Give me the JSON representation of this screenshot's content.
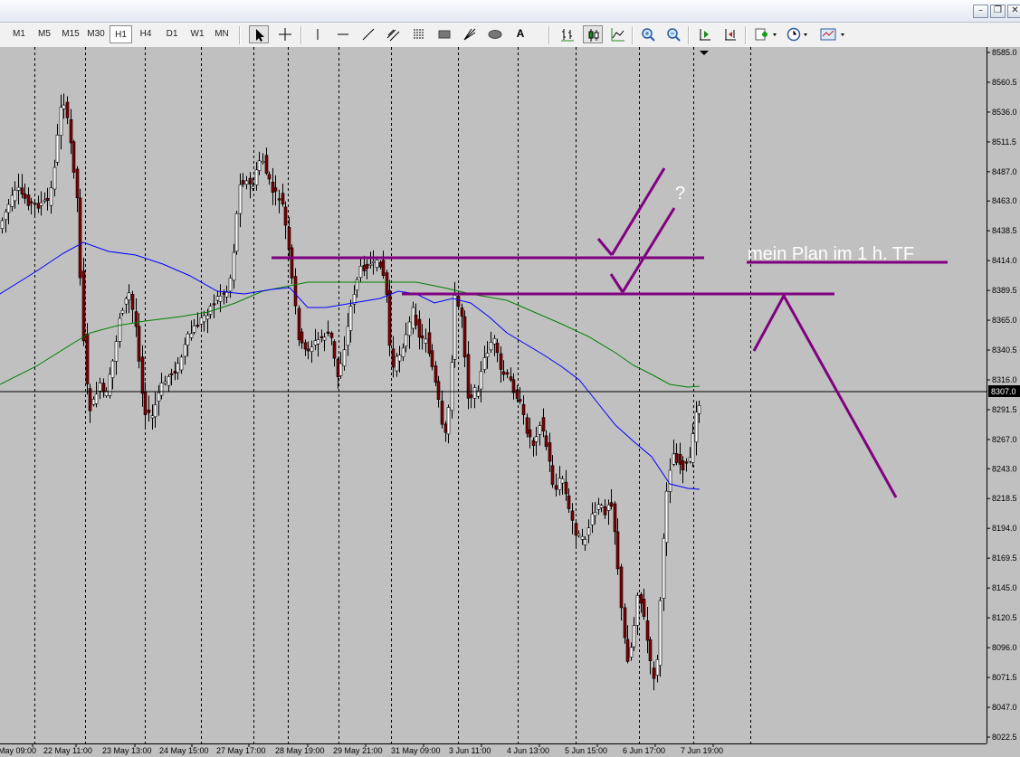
{
  "window": {
    "minimize_icon": "–",
    "restore_icon": "❐",
    "close_icon": "✕"
  },
  "toolbar": {
    "timeframes": [
      "M1",
      "M5",
      "M15",
      "M30",
      "H1",
      "H4",
      "D1",
      "W1",
      "MN"
    ],
    "active_timeframe": "H1",
    "text_tool_label": "A",
    "side_button_label": "4"
  },
  "chart_data": {
    "type": "candlestick",
    "current_price_label": "8307.0",
    "y_ticks": [
      "8585.0",
      "8560.5",
      "8536.0",
      "8511.5",
      "8487.0",
      "8463.0",
      "8438.5",
      "8414.0",
      "8389.5",
      "8365.0",
      "8340.5",
      "8316.0",
      "8291.5",
      "8267.0",
      "8243.0",
      "8218.5",
      "8194.0",
      "8169.5",
      "8145.0",
      "8120.5",
      "8096.0",
      "8071.5",
      "8047.0",
      "8022.5"
    ],
    "x_ticks": [
      "May 09:00",
      "22 May 11:00",
      "23 May 13:00",
      "24 May 15:00",
      "27 May 17:00",
      "28 May 19:00",
      "29 May 21:00",
      "31 May 09:00",
      "3 Jun 11:00",
      "4 Jun 13:00",
      "5 Jun 15:00",
      "6 Jun 17:00",
      "7 Jun 19:00"
    ],
    "y_range": [
      8022.5,
      8585.0
    ],
    "grid": "vertical-dashed",
    "annotation_plan": "mein Plan im 1 h. TF",
    "annotation_question": "?",
    "colors": {
      "background": "#c0c0c0",
      "bull_candle": "#ffffff",
      "bear_candle": "#800000",
      "ma_fast": "#0000ff",
      "ma_slow": "#008000",
      "annotations": "#800080"
    }
  }
}
